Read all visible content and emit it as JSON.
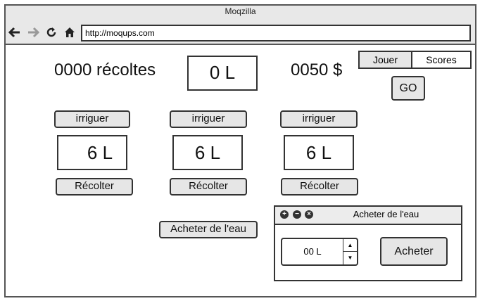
{
  "window": {
    "title": "Moqzilla"
  },
  "nav": {
    "url": "http://moqups.com"
  },
  "stats": {
    "harvests": "0000 récoltes",
    "water": "0 L",
    "money": "0050 $"
  },
  "tabs": [
    {
      "label": "Jouer"
    },
    {
      "label": "Scores"
    }
  ],
  "go_label": "GO",
  "plots": [
    {
      "irrigate": "irriguer",
      "water": "6 L",
      "harvest": "Récolter"
    },
    {
      "irrigate": "irriguer",
      "water": "6 L",
      "harvest": "Récolter"
    },
    {
      "irrigate": "irriguer",
      "water": "6 L",
      "harvest": "Récolter"
    }
  ],
  "buy_water_label": "Acheter de l'eau",
  "dialog": {
    "title": "Acheter de l'eau",
    "quantity": "00 L",
    "buy_label": "Acheter"
  }
}
